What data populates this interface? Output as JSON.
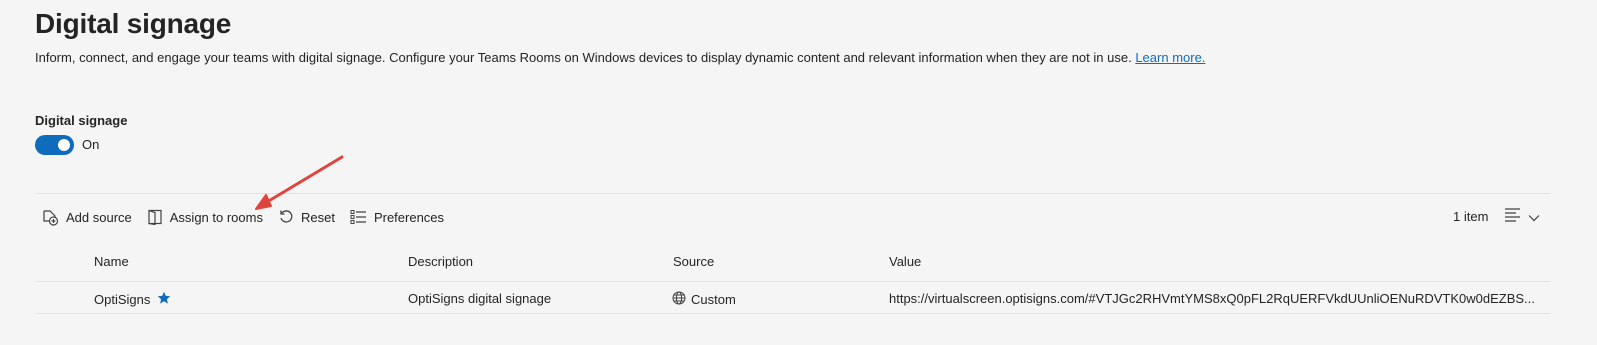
{
  "page": {
    "title": "Digital signage",
    "description": "Inform, connect, and engage your teams with digital signage. Configure your Teams Rooms on Windows devices to display dynamic content and relevant information when they are not in use.",
    "learn_more": "Learn more."
  },
  "setting": {
    "label": "Digital signage",
    "state": "On",
    "enabled": true
  },
  "toolbar": {
    "add_source": "Add source",
    "assign_to_rooms": "Assign to rooms",
    "reset": "Reset",
    "preferences": "Preferences",
    "item_count": "1 item"
  },
  "table": {
    "columns": {
      "name": "Name",
      "description": "Description",
      "source": "Source",
      "value": "Value"
    },
    "rows": [
      {
        "name": "OptiSigns",
        "default": true,
        "description": "OptiSigns digital signage",
        "source": "Custom",
        "value": "https://virtualscreen.optisigns.com/#VTJGc2RHVmtYMS8xQ0pFL2RqUERFVkdUUnliOENuRDVTK0w0dEZBS..."
      }
    ]
  },
  "colors": {
    "accent": "#0f6cbd",
    "annotation_arrow": "#e0443e"
  },
  "icons": {
    "add_source": "add-source-icon",
    "assign": "assign-to-rooms-icon",
    "reset": "reset-icon",
    "preferences": "preferences-icon",
    "view": "view-list-icon",
    "default_star": "star-icon",
    "source": "globe-icon"
  }
}
